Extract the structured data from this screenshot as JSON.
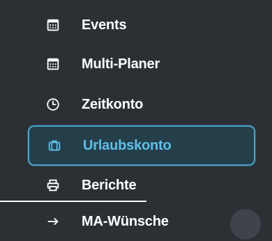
{
  "menu": {
    "items": [
      {
        "label": "Events",
        "icon": "calendar-icon"
      },
      {
        "label": "Multi-Planer",
        "icon": "calendar-icon"
      },
      {
        "label": "Zeitkonto",
        "icon": "clock-icon"
      },
      {
        "label": "Urlaubskonto",
        "icon": "suitcase-icon",
        "active": true
      },
      {
        "label": "Berichte",
        "icon": "printer-icon"
      },
      {
        "label": "MA-Wünsche",
        "icon": "arrow-right-icon"
      }
    ]
  },
  "colors": {
    "background": "#2b3035",
    "text": "#ffffff",
    "active_text": "#5fbfe8",
    "active_border": "#4aa3c9",
    "active_background": "#243f4a"
  }
}
